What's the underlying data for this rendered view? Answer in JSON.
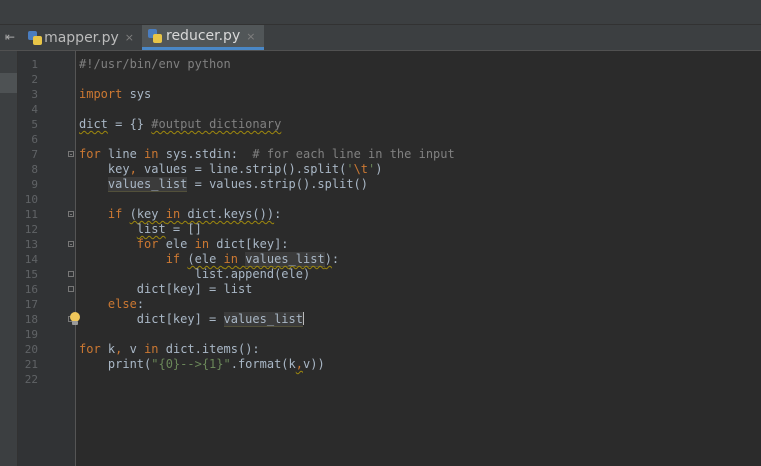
{
  "tabs": [
    {
      "label": "mapper.py",
      "active": false,
      "close_glyph": "×"
    },
    {
      "label": "reducer.py",
      "active": true,
      "close_glyph": "×"
    }
  ],
  "tab_strip_glyph": "⇤",
  "editor": {
    "line_numbers": [
      "1",
      "2",
      "3",
      "4",
      "5",
      "6",
      "7",
      "8",
      "9",
      "10",
      "11",
      "12",
      "13",
      "14",
      "15",
      "16",
      "17",
      "18",
      "19",
      "20",
      "21",
      "22"
    ],
    "code_lines": [
      [
        {
          "t": "#!/usr/bin/env python",
          "c": "cm"
        }
      ],
      [],
      [
        {
          "t": "import",
          "c": "kw"
        },
        {
          "t": " sys"
        }
      ],
      [],
      [
        {
          "t": "dict",
          "c": "wavy"
        },
        {
          "t": " = {} "
        },
        {
          "t": "#output dictionary",
          "c": "cm wavy"
        }
      ],
      [],
      [
        {
          "t": "for",
          "c": "kw"
        },
        {
          "t": " line "
        },
        {
          "t": "in",
          "c": "kw"
        },
        {
          "t": " sys.stdin:  "
        },
        {
          "t": "# for each line in the input",
          "c": "cm"
        }
      ],
      [
        {
          "t": "    key"
        },
        {
          "t": ",",
          "c": "kw"
        },
        {
          "t": " values = line.strip().split("
        },
        {
          "t": "'",
          "c": "str"
        },
        {
          "t": "\\t",
          "c": "esc"
        },
        {
          "t": "'",
          "c": "str"
        },
        {
          "t": ")"
        }
      ],
      [
        {
          "t": "    "
        },
        {
          "t": "values_list",
          "c": "var"
        },
        {
          "t": " = values.strip().split()"
        }
      ],
      [],
      [
        {
          "t": "    "
        },
        {
          "t": "if",
          "c": "kw"
        },
        {
          "t": " "
        },
        {
          "t": "(key ",
          "c": "wavy"
        },
        {
          "t": "in",
          "c": "kw wavy"
        },
        {
          "t": " dict.keys())",
          "c": "wavy"
        },
        {
          "t": ":"
        }
      ],
      [
        {
          "t": "        "
        },
        {
          "t": "list",
          "c": "wavy"
        },
        {
          "t": " = []"
        }
      ],
      [
        {
          "t": "        "
        },
        {
          "t": "for",
          "c": "kw"
        },
        {
          "t": " ele "
        },
        {
          "t": "in",
          "c": "kw"
        },
        {
          "t": " dict[key]:"
        }
      ],
      [
        {
          "t": "            "
        },
        {
          "t": "if",
          "c": "kw"
        },
        {
          "t": " "
        },
        {
          "t": "(ele ",
          "c": "wavy"
        },
        {
          "t": "in",
          "c": "kw wavy"
        },
        {
          "t": " ",
          "c": "wavy"
        },
        {
          "t": "values_list",
          "c": "var wavy"
        },
        {
          "t": ")",
          "c": "wavy"
        },
        {
          "t": ":"
        }
      ],
      [
        {
          "t": "                list.append(ele)"
        }
      ],
      [
        {
          "t": "        dict[key] = list"
        }
      ],
      [
        {
          "t": "    "
        },
        {
          "t": "else",
          "c": "kw"
        },
        {
          "t": ":"
        }
      ],
      [
        {
          "t": "        dict[key] = "
        },
        {
          "t": "values_list",
          "c": "var"
        },
        {
          "t": "",
          "c": "cursor"
        }
      ],
      [],
      [
        {
          "t": "for",
          "c": "kw"
        },
        {
          "t": " k"
        },
        {
          "t": ",",
          "c": "kw"
        },
        {
          "t": " v "
        },
        {
          "t": "in",
          "c": "kw"
        },
        {
          "t": " dict.items():"
        }
      ],
      [
        {
          "t": "    print("
        },
        {
          "t": "\"{0}-->{1}\"",
          "c": "str"
        },
        {
          "t": ".format(k"
        },
        {
          "t": ",",
          "c": "kw wavy"
        },
        {
          "t": "v))"
        }
      ],
      []
    ],
    "fold_markers": [
      {
        "line": 7,
        "kind": "start"
      },
      {
        "line": 11,
        "kind": "start"
      },
      {
        "line": 13,
        "kind": "start"
      },
      {
        "line": 15,
        "kind": "end"
      },
      {
        "line": 16,
        "kind": "end"
      },
      {
        "line": 18,
        "kind": "end"
      }
    ],
    "intention_bulb_line": 18
  }
}
